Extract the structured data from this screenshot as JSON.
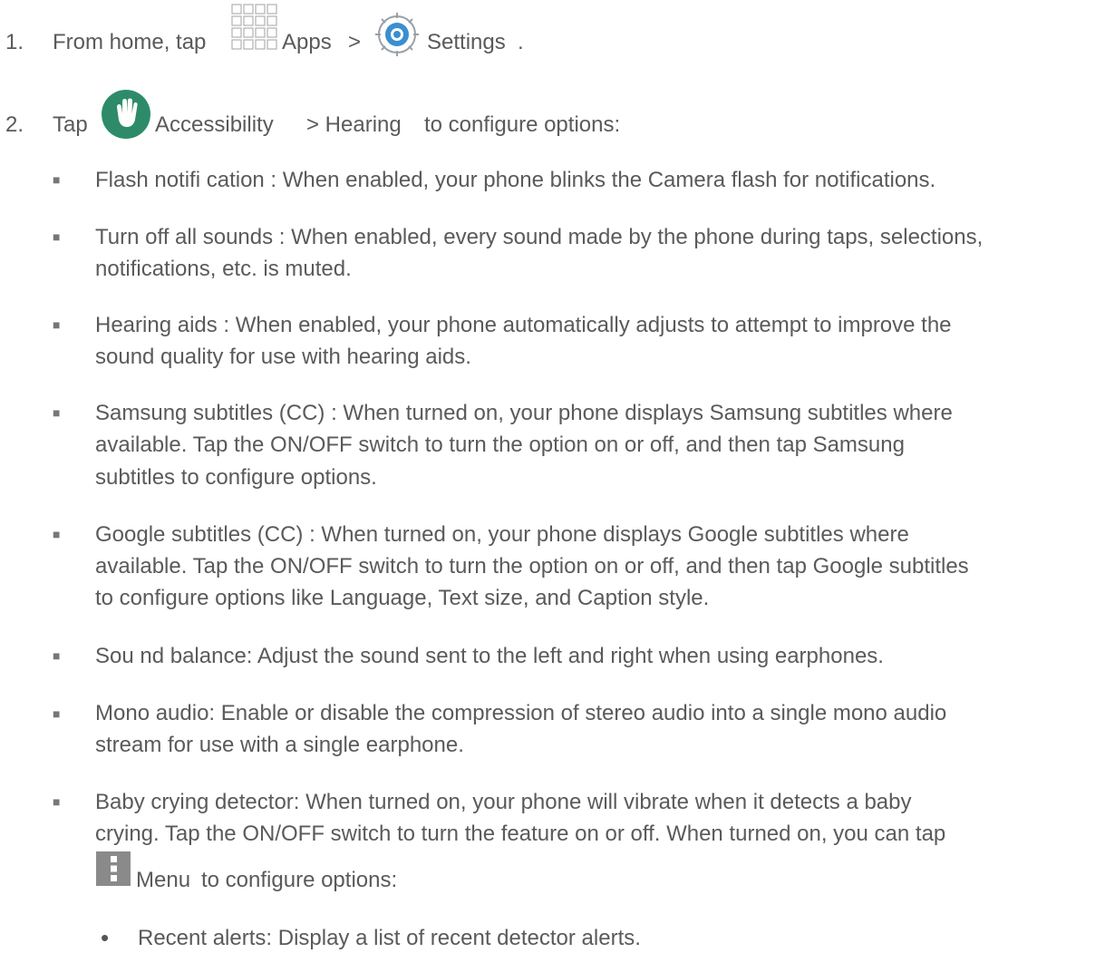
{
  "steps": [
    {
      "number": "1.",
      "text_before": "From home, tap",
      "icon1": "apps-grid-icon",
      "label1": "Apps",
      "separator": ">",
      "icon2": "settings-gear-icon",
      "label2": "Settings",
      "end": "."
    },
    {
      "number": "2.",
      "text_before": "Tap",
      "icon1": "accessibility-hand-icon",
      "label1": "Accessibility",
      "separator": "> Hearing",
      "rest": "to configure options:"
    }
  ],
  "bullet_char": "■",
  "sub_bullet_char": "•",
  "items": [
    {
      "lines": [
        "Flash notifi  cation : When enabled, your phone blinks the Camera flash for notifications."
      ]
    },
    {
      "lines": [
        "Turn off all sounds   : When enabled, every sound made by the phone during taps, selections,",
        "notifications, etc. is muted."
      ]
    },
    {
      "lines": [
        "Hearing aids : When enabled, your phone automatically adjusts to attempt to improve the",
        "sound quality for use with hearing aids."
      ]
    },
    {
      "lines": [
        "Samsung subtitles (CC)   : When turned on, your phone displays Samsung subtitles where",
        "available. Tap the ON/OFF switch to turn the option on or off, and then tap Samsung",
        "subtitles   to configure options."
      ]
    },
    {
      "lines": [
        "Google subtitles (CC)  : When turned on, your phone displays Google subtitles where",
        "available. Tap the ON/OFF switch to turn the option on or off, and then tap Google subtitles",
        "to configure options like Language, Text size, and Caption style."
      ]
    },
    {
      "lines": [
        "Sou nd  balance: Adjust the sound sent to the left and right when using earphones."
      ]
    },
    {
      "lines": [
        "Mono audio: Enable or disable the compression of stereo audio into a single mono audio",
        "stream for use with a single earphone."
      ]
    },
    {
      "lines": [
        "Baby crying detector:    When turned on, your phone will vibrate when it detects a baby",
        "crying. Tap the ON/OFF switch to turn the feature on or off. When turned on, you can tap"
      ],
      "icon": "menu-more-icon",
      "icon_label": "Menu",
      "after_icon": "to configure options:"
    }
  ],
  "sub_items": [
    "Recent alerts: Display a list of recent  detector alerts."
  ],
  "colors": {
    "text": "#5a5a5a",
    "accessibility_icon": "#2e8b6a",
    "settings_icon": "#3a8fd0",
    "apps_grid": "#b0b0b0",
    "menu_icon": "#8a8a8a"
  }
}
